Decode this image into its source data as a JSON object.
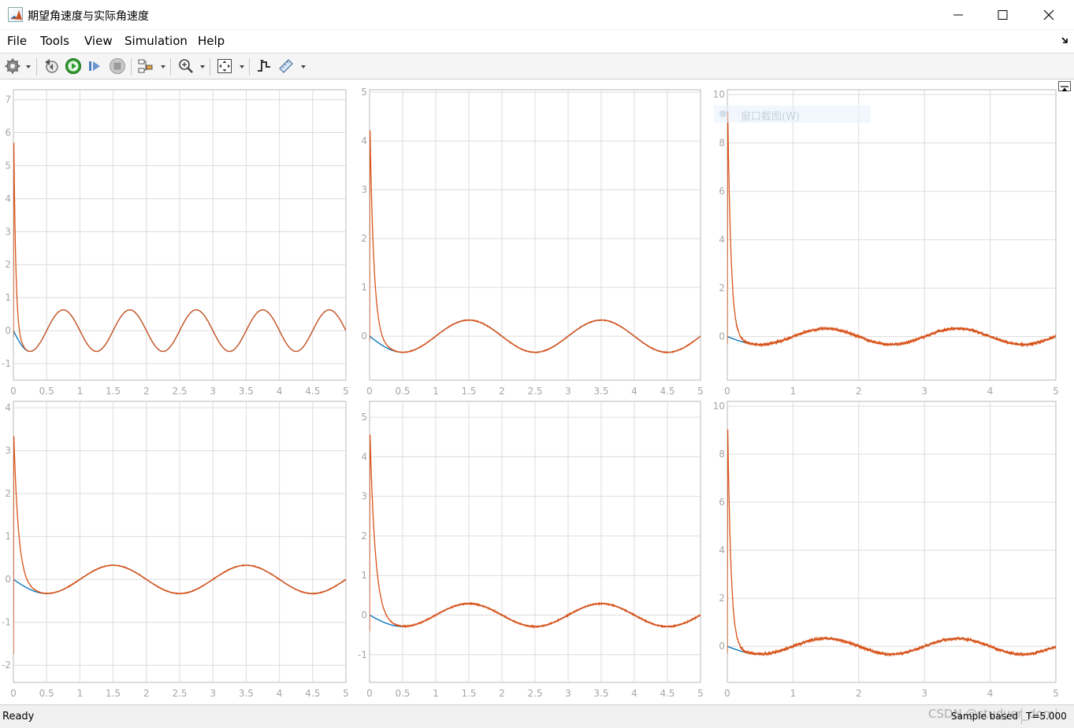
{
  "window": {
    "title": "期望角速度与实际角速度",
    "app_icon": "matlab-icon",
    "controls": [
      "minimize-icon",
      "maximize-icon",
      "close-icon"
    ]
  },
  "menu": {
    "items": [
      {
        "label": "File"
      },
      {
        "label": "Tools"
      },
      {
        "label": "View"
      },
      {
        "label": "Simulation"
      },
      {
        "label": "Help"
      }
    ],
    "undock_icon": "undock-arrow-icon"
  },
  "toolbar": {
    "buttons": [
      {
        "icon": "gear-icon",
        "dropdown": true
      },
      {
        "icon": "step-back-icon",
        "dropdown": false
      },
      {
        "icon": "run-icon",
        "dropdown": false
      },
      {
        "icon": "step-forward-icon",
        "dropdown": false
      },
      {
        "icon": "stop-icon",
        "dropdown": false
      },
      {
        "icon": "highlight-signal-icon",
        "dropdown": true
      },
      {
        "icon": "zoom-in-icon",
        "dropdown": true
      },
      {
        "icon": "autoscale-icon",
        "dropdown": true
      },
      {
        "icon": "triggers-icon",
        "dropdown": false
      },
      {
        "icon": "measurements-icon",
        "dropdown": true
      }
    ]
  },
  "scope": {
    "restore_icon": "restore-layout-icon",
    "ghost_tooltip": "窗口截图(W)",
    "colors": {
      "desired": "#0072BD",
      "actual": "#D95319",
      "grid": "#dcdcdc",
      "axis_text": "#a6a6a6"
    }
  },
  "status": {
    "ready": "Ready",
    "sample": "Sample based",
    "time": "T=5.000",
    "watermark": "CSDN @studyer_domi"
  },
  "chart_data": [
    {
      "type": "line",
      "xlim": [
        0,
        5
      ],
      "ylim": [
        -1.5,
        7.3
      ],
      "xticks": [
        "0",
        "0.5",
        "1",
        "1.5",
        "2",
        "2.5",
        "3",
        "3.5",
        "4",
        "4.5",
        "5"
      ],
      "yticks": [
        "-1",
        "0",
        "1",
        "2",
        "3",
        "4",
        "5",
        "6",
        "7"
      ],
      "grid": true,
      "series": [
        {
          "color": "#0072BD",
          "shape": "sine",
          "amplitude": 0.63,
          "period": 1,
          "phase": 0,
          "noise": 0
        },
        {
          "color": "#D95319",
          "shape": "sine",
          "amplitude": 0.63,
          "period": 1,
          "phase": 0,
          "noise": 0,
          "spike_peak": 6.35,
          "spike_min": -0.2,
          "decay": 0.03
        }
      ]
    },
    {
      "type": "line",
      "xlim": [
        0,
        5
      ],
      "ylim": [
        -0.9,
        5.05
      ],
      "xticks": [
        "0",
        "0.5",
        "1",
        "1.5",
        "2",
        "2.5",
        "3",
        "3.5",
        "4",
        "4.5",
        "5"
      ],
      "yticks": [
        "0",
        "1",
        "2",
        "3",
        "4",
        "5"
      ],
      "grid": true,
      "series": [
        {
          "color": "#0072BD",
          "shape": "sine",
          "amplitude": 0.33,
          "period": 2,
          "phase": 0,
          "noise": 0
        },
        {
          "color": "#D95319",
          "shape": "sine",
          "amplitude": 0.33,
          "period": 2,
          "phase": 0,
          "noise": 0.012,
          "spike_peak": 4.45,
          "spike_min": -0.1,
          "decay": 0.06
        }
      ]
    },
    {
      "type": "line",
      "xlim": [
        0,
        5
      ],
      "ylim": [
        -1.8,
        10.2
      ],
      "xticks": [
        "0",
        "1",
        "2",
        "3",
        "4",
        "5"
      ],
      "yticks": [
        "0",
        "2",
        "4",
        "6",
        "8",
        "10"
      ],
      "grid": true,
      "series": [
        {
          "color": "#0072BD",
          "shape": "sine",
          "amplitude": 0.33,
          "period": 2,
          "phase": 0,
          "noise": 0
        },
        {
          "color": "#D95319",
          "shape": "sine",
          "amplitude": 0.33,
          "period": 2,
          "phase": 0,
          "noise": 0.05,
          "spike_peak": 9.9,
          "spike_min": -0.3,
          "decay": 0.05
        }
      ]
    },
    {
      "type": "line",
      "xlim": [
        0,
        5
      ],
      "ylim": [
        -2.4,
        4.15
      ],
      "xticks": [
        "0",
        "0.5",
        "1",
        "1.5",
        "2",
        "2.5",
        "3",
        "3.5",
        "4",
        "4.5",
        "5"
      ],
      "yticks": [
        "-2",
        "-1",
        "0",
        "1",
        "2",
        "3",
        "4"
      ],
      "grid": true,
      "series": [
        {
          "color": "#0072BD",
          "shape": "sine",
          "amplitude": 0.33,
          "period": 2,
          "phase": 0,
          "noise": 0
        },
        {
          "color": "#D95319",
          "shape": "sine",
          "amplitude": 0.33,
          "period": 2,
          "phase": 0,
          "noise": 0.012,
          "spike_peak": 3.5,
          "spike_min": -1.75,
          "decay": 0.07
        }
      ]
    },
    {
      "type": "line",
      "xlim": [
        0,
        5
      ],
      "ylim": [
        -1.7,
        5.4
      ],
      "xticks": [
        "0",
        "0.5",
        "1",
        "1.5",
        "2",
        "2.5",
        "3",
        "3.5",
        "4",
        "4.5",
        "5"
      ],
      "yticks": [
        "-1",
        "0",
        "1",
        "2",
        "3",
        "4",
        "5"
      ],
      "grid": true,
      "series": [
        {
          "color": "#0072BD",
          "shape": "sine",
          "amplitude": 0.29,
          "period": 2,
          "phase": 0,
          "noise": 0
        },
        {
          "color": "#D95319",
          "shape": "sine",
          "amplitude": 0.29,
          "period": 2,
          "phase": 0,
          "noise": 0.02,
          "spike_peak": 4.75,
          "spike_min": -0.4,
          "decay": 0.08
        }
      ]
    },
    {
      "type": "line",
      "xlim": [
        0,
        5
      ],
      "ylim": [
        -1.5,
        10.2
      ],
      "xticks": [
        "0",
        "1",
        "2",
        "3",
        "4",
        "5"
      ],
      "yticks": [
        "0",
        "2",
        "4",
        "6",
        "8",
        "10"
      ],
      "grid": true,
      "series": [
        {
          "color": "#0072BD",
          "shape": "sine",
          "amplitude": 0.33,
          "period": 2,
          "phase": 0,
          "noise": 0
        },
        {
          "color": "#D95319",
          "shape": "sine",
          "amplitude": 0.33,
          "period": 2,
          "phase": 0,
          "noise": 0.05,
          "spike_peak": 9.6,
          "spike_min": -0.3,
          "decay": 0.05
        }
      ]
    }
  ]
}
